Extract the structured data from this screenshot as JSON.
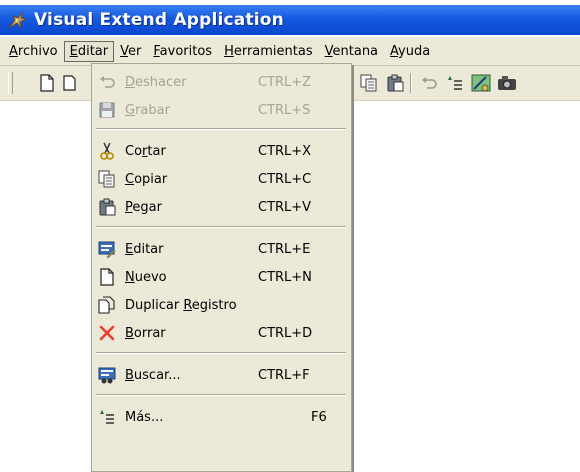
{
  "window": {
    "title": "Visual Extend Application"
  },
  "menubar": {
    "items": [
      {
        "label": "Archivo",
        "u": "A",
        "rest": "rchivo"
      },
      {
        "label": "Editar",
        "u": "E",
        "rest": "ditar"
      },
      {
        "label": "Ver",
        "u": "V",
        "rest": "er"
      },
      {
        "label": "Favoritos",
        "u": "F",
        "rest": "avoritos"
      },
      {
        "label": "Herramientas",
        "u": "H",
        "rest": "erramientas"
      },
      {
        "label": "Ventana",
        "u": "V",
        "rest": "entana"
      },
      {
        "label": "Ayuda",
        "u": "A",
        "rest": "yuda"
      }
    ]
  },
  "edit_menu": {
    "items": [
      {
        "label": "Deshacer",
        "pre": "",
        "u": "D",
        "post": "eshacer",
        "shortcut": "CTRL+Z",
        "disabled": true,
        "icon": "undo-icon"
      },
      {
        "label": "Grabar",
        "pre": "",
        "u": "G",
        "post": "rabar",
        "shortcut": "CTRL+S",
        "disabled": true,
        "icon": "save-icon"
      },
      {
        "label": "Cortar",
        "pre": "Co",
        "u": "r",
        "post": "tar",
        "shortcut": "CTRL+X",
        "disabled": false,
        "icon": "scissors-icon"
      },
      {
        "label": "Copiar",
        "pre": "",
        "u": "C",
        "post": "opiar",
        "shortcut": "CTRL+C",
        "disabled": false,
        "icon": "copy-icon"
      },
      {
        "label": "Pegar",
        "pre": "",
        "u": "P",
        "post": "egar",
        "shortcut": "CTRL+V",
        "disabled": false,
        "icon": "paste-icon"
      },
      {
        "label": "Editar",
        "pre": "",
        "u": "E",
        "post": "ditar",
        "shortcut": "CTRL+E",
        "disabled": false,
        "icon": "edit-form-icon"
      },
      {
        "label": "Nuevo",
        "pre": "",
        "u": "N",
        "post": "uevo",
        "shortcut": "CTRL+N",
        "disabled": false,
        "icon": "new-document-icon"
      },
      {
        "label": "Duplicar Registro",
        "pre": "Duplicar ",
        "u": "R",
        "post": "egistro",
        "shortcut": "",
        "disabled": false,
        "icon": "duplicate-icon"
      },
      {
        "label": "Borrar",
        "pre": "",
        "u": "B",
        "post": "orrar",
        "shortcut": "CTRL+D",
        "disabled": false,
        "icon": "delete-x-icon"
      },
      {
        "label": "Buscar...",
        "pre": "",
        "u": "B",
        "post": "uscar...",
        "shortcut": "CTRL+F",
        "disabled": false,
        "icon": "search-binoculars-icon"
      },
      {
        "label": "Más...",
        "pre": "Más...",
        "u": "",
        "post": "",
        "shortcut": "F6",
        "disabled": false,
        "icon": "more-options-icon"
      }
    ]
  },
  "toolbar": {
    "icons": [
      "new-document-icon",
      "copy-document-icon",
      "copy-icon",
      "paste-icon",
      "undo-icon",
      "more-options-icon",
      "tools-icon",
      "camera-icon"
    ]
  },
  "colors": {
    "title_bar": "#0a46cf",
    "menu_bg": "#ece9d8",
    "disabled_text": "#a6a393",
    "delete_x": "#e8402b"
  }
}
